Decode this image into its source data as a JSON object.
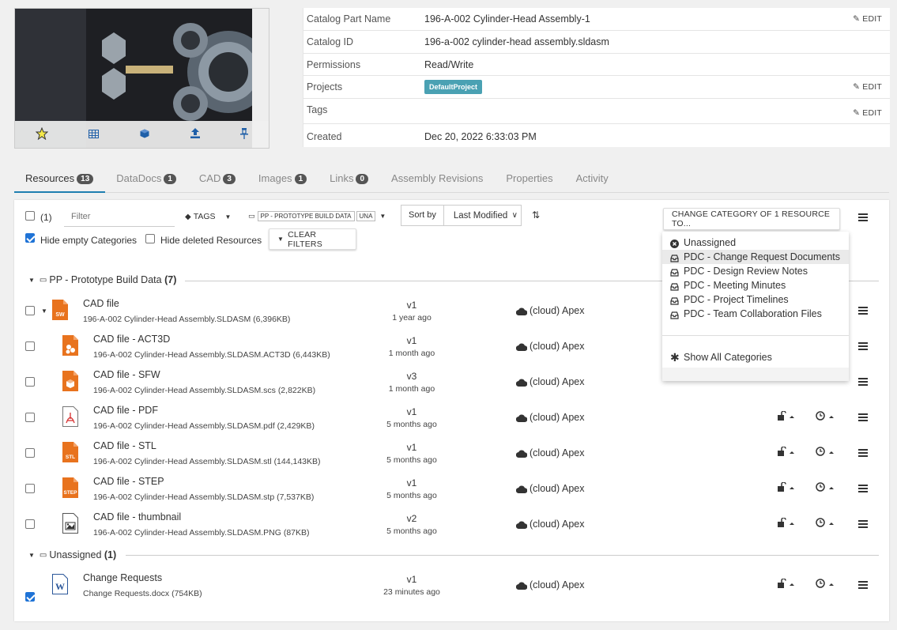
{
  "part": {
    "rows": [
      {
        "label": "Catalog Part Name",
        "value": "196-A-002 Cylinder-Head Assembly-1",
        "edit": "EDIT"
      },
      {
        "label": "Catalog ID",
        "value": "196-a-002 cylinder-head assembly.sldasm"
      },
      {
        "label": "Permissions",
        "value": "Read/Write"
      },
      {
        "label": "Projects",
        "value": "DefaultProject",
        "edit": "EDIT"
      },
      {
        "label": "Tags",
        "value": "",
        "edit": "EDIT"
      },
      {
        "label": "Created",
        "value": "Dec 20, 2022 6:33:03 PM"
      }
    ],
    "thumb_icons": [
      "star-icon",
      "table-icon",
      "cube-icon",
      "upload-icon",
      "pin-icon"
    ]
  },
  "tabs": [
    {
      "label": "Resources",
      "count": "13"
    },
    {
      "label": "DataDocs",
      "count": "1"
    },
    {
      "label": "CAD",
      "count": "3"
    },
    {
      "label": "Images",
      "count": "1"
    },
    {
      "label": "Links",
      "count": "0"
    },
    {
      "label": "Assembly Revisions",
      "count": null
    },
    {
      "label": "Properties",
      "count": null
    },
    {
      "label": "Activity",
      "count": null
    }
  ],
  "toolbar": {
    "select_count": "(1)",
    "filter_placeholder": "Filter",
    "tags_label": "TAGS",
    "category_chip": "PP - PROTOTYPE BUILD DATA",
    "category_chip2": "UNA",
    "sort_by_label": "Sort by",
    "sort_value": "Last Modified",
    "change_category_btn": "CHANGE CATEGORY OF 1 RESOURCE TO...",
    "hide_empty_label": "Hide empty Categories",
    "hide_deleted_label": "Hide deleted Resources",
    "clear_filters": "CLEAR FILTERS"
  },
  "dropdown": {
    "items": [
      "Unassigned",
      "PDC - Change Request Documents",
      "PDC - Design Review Notes",
      "PDC - Meeting Minutes",
      "PDC - Project Timelines",
      "PDC - Team Collaboration Files"
    ],
    "show_all": "Show All Categories"
  },
  "categories": [
    {
      "name": "PP - Prototype Build Data",
      "count": "(7)"
    },
    {
      "name": "Unassigned",
      "count": "(1)"
    }
  ],
  "resources": [
    {
      "name": "CAD file",
      "file": "196-A-002 Cylinder-Head Assembly.SLDASM (6,396KB)",
      "version": "v1",
      "age": "1 year ago",
      "location": "(cloud) Apex",
      "icon_label": "SW"
    },
    {
      "name": "CAD file - ACT3D",
      "file": "196-A-002 Cylinder-Head Assembly.SLDASM.ACT3D (6,443KB)",
      "version": "v1",
      "age": "1 month ago",
      "location": "(cloud) Apex"
    },
    {
      "name": "CAD file - SFW",
      "file": "196-A-002 Cylinder-Head Assembly.SLDASM.scs (2,822KB)",
      "version": "v3",
      "age": "1 month ago",
      "location": "(cloud) Apex"
    },
    {
      "name": "CAD file - PDF",
      "file": "196-A-002 Cylinder-Head Assembly.SLDASM.pdf (2,429KB)",
      "version": "v1",
      "age": "5 months ago",
      "location": "(cloud) Apex"
    },
    {
      "name": "CAD file - STL",
      "file": "196-A-002 Cylinder-Head Assembly.SLDASM.stl (144,143KB)",
      "version": "v1",
      "age": "5 months ago",
      "location": "(cloud) Apex",
      "icon_label": "STL"
    },
    {
      "name": "CAD file - STEP",
      "file": "196-A-002 Cylinder-Head Assembly.SLDASM.stp (7,537KB)",
      "version": "v1",
      "age": "5 months ago",
      "location": "(cloud) Apex",
      "icon_label": "STEP"
    },
    {
      "name": "CAD file - thumbnail",
      "file": "196-A-002 Cylinder-Head Assembly.SLDASM.PNG (87KB)",
      "version": "v2",
      "age": "5 months ago",
      "location": "(cloud) Apex"
    },
    {
      "name": "Change Requests",
      "file": "Change Requests.docx (754KB)",
      "version": "v1",
      "age": "23 minutes ago",
      "location": "(cloud) Apex",
      "icon_label": "W"
    }
  ],
  "colors": {
    "accent": "#1f7fb0",
    "project_badge": "#4aa1b3",
    "checkbox": "#1f73d6",
    "file_orange": "#e8731e"
  }
}
